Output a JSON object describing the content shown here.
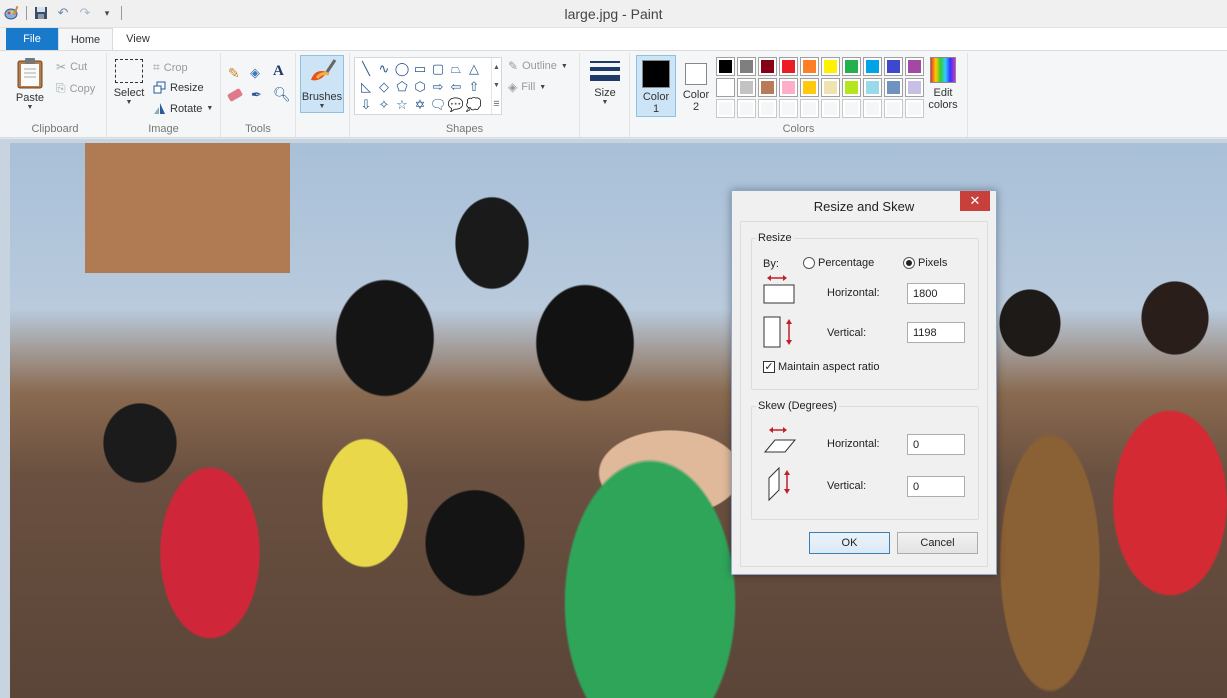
{
  "window": {
    "title": "large.jpg - Paint"
  },
  "quick_access": {
    "icons": [
      "paint-app-icon",
      "save-icon",
      "undo-icon",
      "redo-icon",
      "customize-dropdown-icon"
    ]
  },
  "tabs": [
    {
      "label": "File",
      "active": false
    },
    {
      "label": "Home",
      "active": true
    },
    {
      "label": "View",
      "active": false
    }
  ],
  "ribbon": {
    "clipboard": {
      "label": "Clipboard",
      "paste": "Paste",
      "cut": "Cut",
      "copy": "Copy"
    },
    "image": {
      "label": "Image",
      "select": "Select",
      "crop": "Crop",
      "resize": "Resize",
      "rotate": "Rotate"
    },
    "tools": {
      "label": "Tools",
      "items": [
        "pencil",
        "fill",
        "text",
        "eraser",
        "color-picker",
        "magnifier"
      ]
    },
    "brushes": {
      "label": "Brushes"
    },
    "shapes": {
      "label": "Shapes",
      "outline": "Outline",
      "fill": "Fill",
      "glyphs": [
        "╲",
        "∿",
        "◯",
        "▭",
        "▢",
        "⏢",
        "△",
        "◺",
        "◇",
        "⬠",
        "⬡",
        "⇨",
        "⇦",
        "⇧",
        "⇩",
        "✧",
        "☆",
        "✡",
        "🗨",
        "💬",
        "💭"
      ]
    },
    "size": {
      "label": "Size"
    },
    "colors": {
      "label": "Colors",
      "color1_label_line1": "Color",
      "color1_label_line2": "1",
      "color2_label_line1": "Color",
      "color2_label_line2": "2",
      "color1": "#000000",
      "color2": "#ffffff",
      "edit_colors_line1": "Edit",
      "edit_colors_line2": "colors",
      "palette_row1": [
        "#000000",
        "#7f7f7f",
        "#880015",
        "#ed1c24",
        "#ff7f27",
        "#fff200",
        "#22b14c",
        "#00a2e8",
        "#3f48cc",
        "#a349a4"
      ],
      "palette_row2": [
        "#ffffff",
        "#c3c3c3",
        "#b97a57",
        "#ffaec9",
        "#ffc90e",
        "#efe4b0",
        "#b5e61d",
        "#99d9ea",
        "#7092be",
        "#c8bfe7"
      ],
      "palette_row3_empty": 10
    }
  },
  "dialog": {
    "title": "Resize and Skew",
    "close_label": "✕",
    "resize": {
      "legend": "Resize",
      "by_label": "By:",
      "percentage_label": "Percentage",
      "pixels_label": "Pixels",
      "selected": "Pixels",
      "horizontal_label": "Horizontal:",
      "horizontal_value": "1800",
      "vertical_label": "Vertical:",
      "vertical_value": "1198",
      "maintain_aspect_label": "Maintain aspect ratio",
      "maintain_aspect_checked": true
    },
    "skew": {
      "legend": "Skew (Degrees)",
      "horizontal_label": "Horizontal:",
      "horizontal_value": "0",
      "vertical_label": "Vertical:",
      "vertical_value": "0"
    },
    "ok_label": "OK",
    "cancel_label": "Cancel"
  }
}
